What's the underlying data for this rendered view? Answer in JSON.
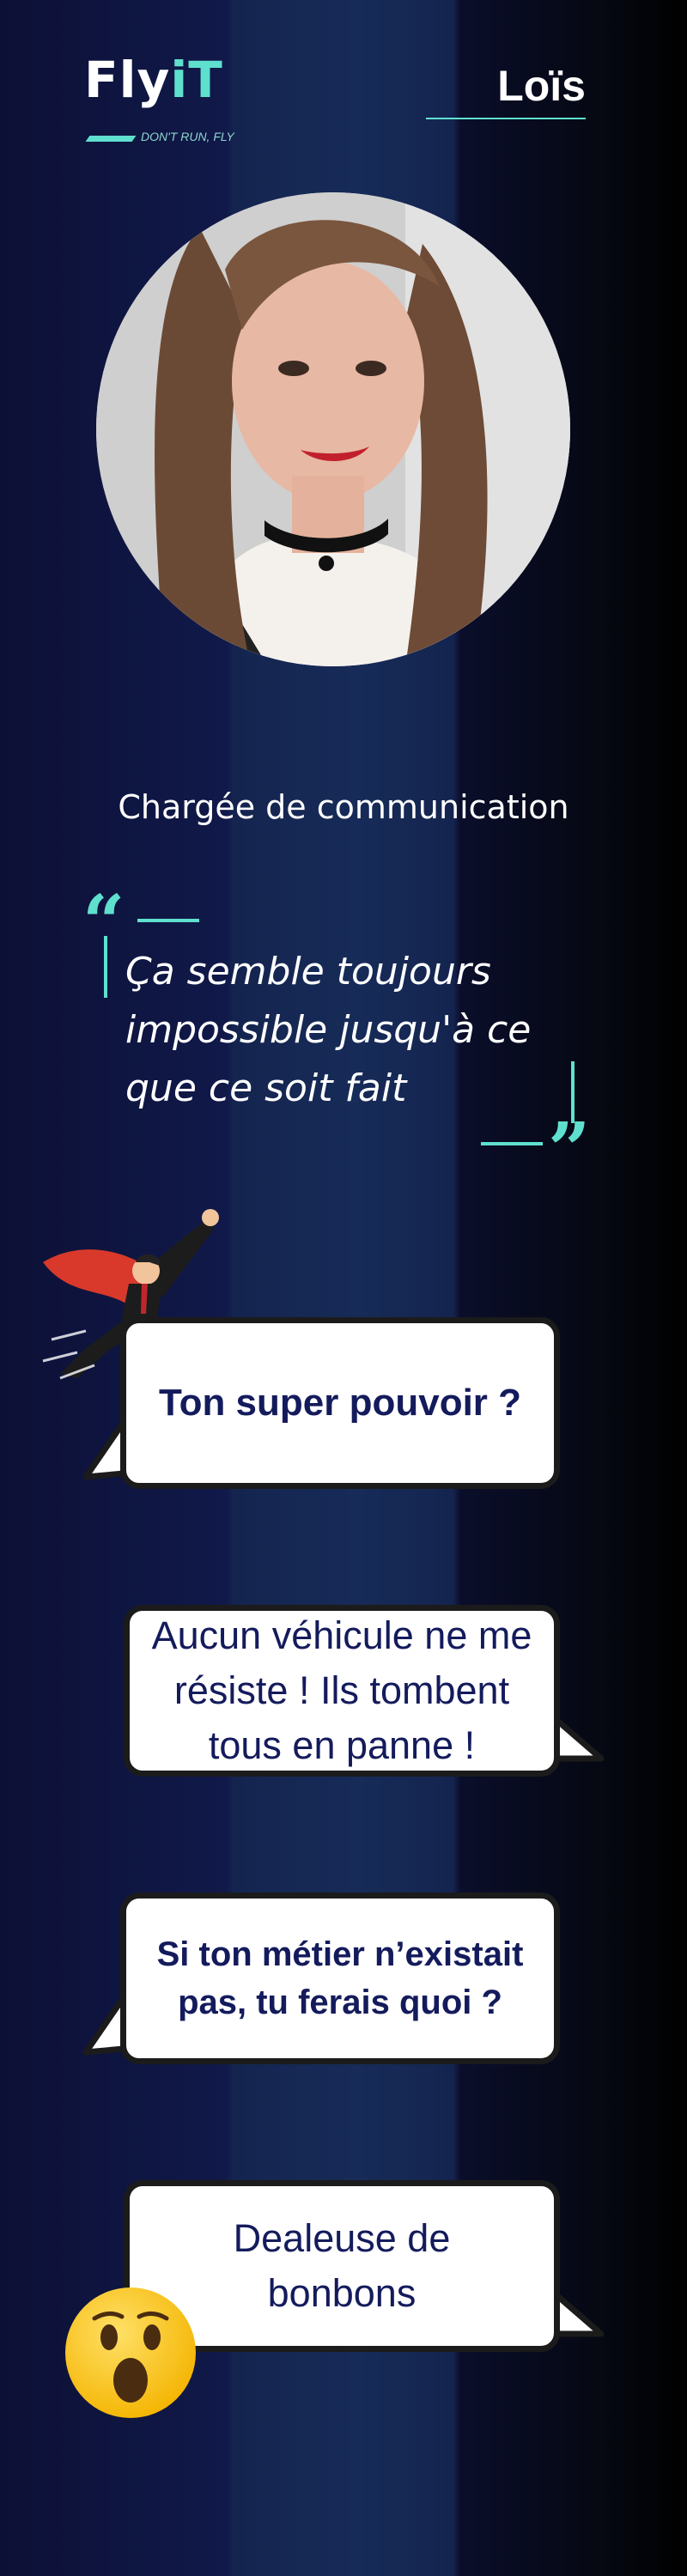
{
  "brand": {
    "logo_text_a": "Fly",
    "logo_text_b": "iT",
    "tagline": "DON'T RUN, FLY",
    "accent_color": "#5fe0cf",
    "text_color": "#141b5c"
  },
  "profile": {
    "name": "Loïs",
    "role": "Chargée de communication",
    "quote": "Ça semble toujours impossible jusqu'à ce que ce soit fait"
  },
  "qa": [
    {
      "question": "Ton super pouvoir ?",
      "answer": "Aucun véhicule ne me résiste ! Ils tombent tous en panne !"
    },
    {
      "question": "Si ton métier n’existait pas, tu ferais quoi ?",
      "answer": "Dealeuse de bonbons"
    }
  ],
  "icons": [
    "superhero-icon",
    "astonished-emoji-icon",
    "quote-open-icon",
    "quote-close-icon"
  ]
}
